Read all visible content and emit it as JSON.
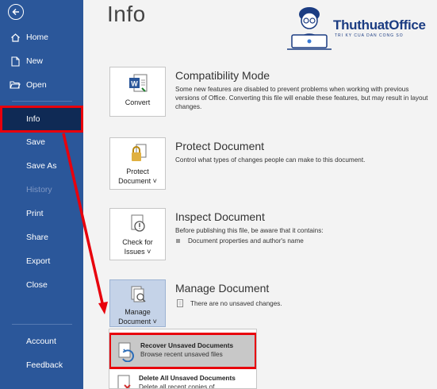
{
  "sidebar": {
    "back_icon": "back-arrow-icon",
    "items": [
      {
        "label": "Home",
        "icon": "home-icon"
      },
      {
        "label": "New",
        "icon": "new-document-icon"
      },
      {
        "label": "Open",
        "icon": "open-folder-icon"
      },
      {
        "label": "Info"
      },
      {
        "label": "Save"
      },
      {
        "label": "Save As"
      },
      {
        "label": "History"
      },
      {
        "label": "Print"
      },
      {
        "label": "Share"
      },
      {
        "label": "Export"
      },
      {
        "label": "Close"
      },
      {
        "label": "Account"
      },
      {
        "label": "Feedback"
      }
    ]
  },
  "page": {
    "title": "Info"
  },
  "logo": {
    "name": "ThuthuatOffice",
    "tagline": "TRI KY CUA DAN CONG SO"
  },
  "sections": {
    "compat": {
      "tile_label": "Convert",
      "title": "Compatibility Mode",
      "description": "Some new features are disabled to prevent problems when working with previous versions of Office. Converting this file will enable these features, but may result in layout changes."
    },
    "protect": {
      "tile_label_1": "Protect",
      "tile_label_2": "Document ˅",
      "title": "Protect Document",
      "description": "Control what types of changes people can make to this document."
    },
    "inspect": {
      "tile_label_1": "Check for",
      "tile_label_2": "Issues ˅",
      "title": "Inspect Document",
      "description": "Before publishing this file, be aware that it contains:",
      "bullet": "Document properties and author's name"
    },
    "manage": {
      "tile_label_1": "Manage",
      "tile_label_2": "Document ˅",
      "title": "Manage Document",
      "status": "There are no unsaved changes."
    }
  },
  "dropdown": {
    "recover": {
      "title": "Recover Unsaved Documents",
      "subtitle": "Browse recent unsaved files"
    },
    "delete": {
      "title": "Delete All Unsaved Documents",
      "subtitle": "Delete all recent copies of"
    }
  },
  "colors": {
    "sidebar": "#2b579a",
    "highlight": "#e8000c",
    "selected": "#0f2a55"
  }
}
